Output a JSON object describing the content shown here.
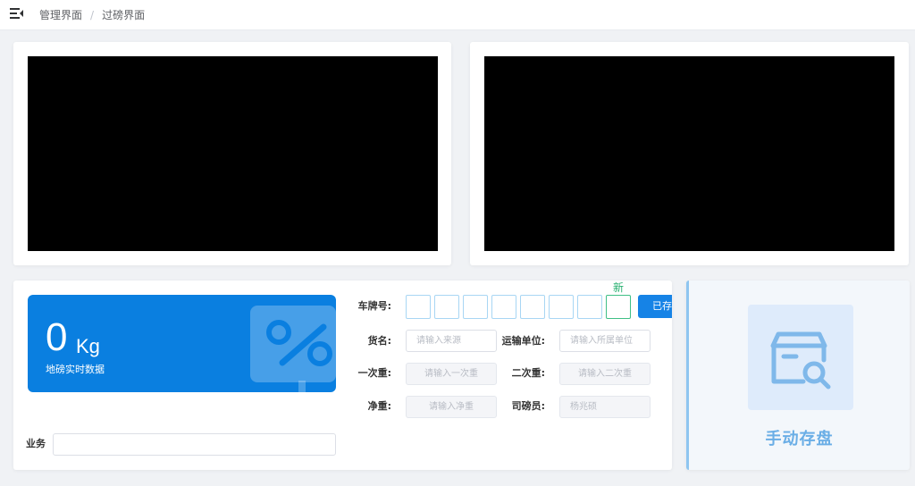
{
  "breadcrumb": {
    "root": "管理界面",
    "separator": "/",
    "current": "过磅界面"
  },
  "weight": {
    "value": "0",
    "unit": "Kg",
    "caption": "地磅实时数据"
  },
  "form": {
    "plate_label": "车牌号:",
    "plate_new_tag": "新",
    "plate_saved_button": "已存",
    "cargo_label": "货名:",
    "cargo_placeholder": "请输入来源",
    "transport_label": "运输单位:",
    "transport_placeholder": "请输入所属单位",
    "first_weight_label": "一次重:",
    "first_weight_placeholder": "请输入一次重",
    "second_weight_label": "二次重:",
    "second_weight_placeholder": "请输入二次重",
    "net_weight_label": "净重:",
    "net_weight_placeholder": "请输入净重",
    "weigher_label": "司磅员:",
    "weigher_value": "杨兆硕",
    "business_label": "业务"
  },
  "manual_save": {
    "label": "手动存盘"
  },
  "colors": {
    "primary": "#0a7fe0",
    "button": "#1683e6",
    "new_tag": "#27b070",
    "manual_text": "#6aaee6"
  }
}
